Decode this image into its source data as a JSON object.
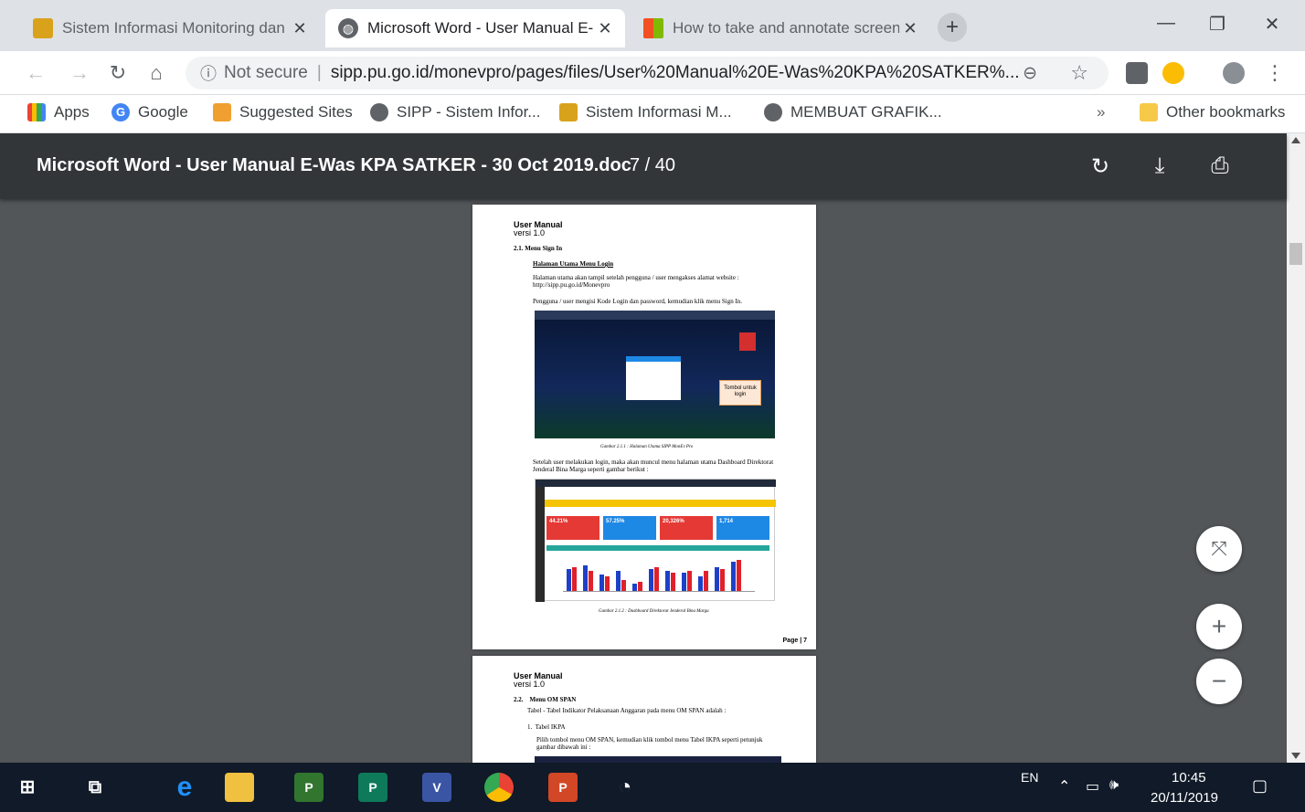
{
  "tabs": [
    {
      "title": "Sistem Informasi Monitoring dan",
      "active": false
    },
    {
      "title": "Microsoft Word - User Manual E-",
      "active": true
    },
    {
      "title": "How to take and annotate screen",
      "active": false
    }
  ],
  "omnibox": {
    "security": "Not secure",
    "url": "sipp.pu.go.id/monevpro/pages/files/User%20Manual%20E-Was%20KPA%20SATKER%..."
  },
  "bookmarks": [
    {
      "label": "Apps",
      "color": "#ea4335"
    },
    {
      "label": "Google",
      "color": "#4285f4"
    },
    {
      "label": "Suggested Sites",
      "color": "#f0a030"
    },
    {
      "label": "SIPP - Sistem Infor...",
      "color": "#5f6368"
    },
    {
      "label": "Sistem Informasi M...",
      "color": "#d9a21b"
    },
    {
      "label": "MEMBUAT GRAFIK...",
      "color": "#5f6368"
    }
  ],
  "bookmarks_overflow": "»",
  "other_bookmarks": "Other bookmarks",
  "pdf": {
    "title": "Microsoft Word - User Manual E-Was KPA SATKER - 30 Oct 2019.doc",
    "page_indicator": "7 / 40",
    "page1": {
      "header": "User Manual",
      "version": "versi 1.0",
      "section": "2.1. Menu Sign In",
      "subheading": "Halaman Utama Menu Login",
      "para1": "Halaman utama akan tampil setelah pengguna / user mengakses alamat website : http://sipp.pu.go.id/Monevpro",
      "para2": "Pengguna / user mengisi Kode Login dan password, kemudian klik menu Sign In.",
      "callout": "Tombol untuk login",
      "caption1": "Gambar 2.1.1 : Halaman Utama SIPP MonEv Pro",
      "para3": "Setelah user melakukan login, maka akan muncul menu halaman utama Dashboard Direktorat Jenderal Bina Marga seperti gambar berikut :",
      "stats": [
        "44.21%",
        "57.25%",
        "20,326%",
        "1,714"
      ],
      "caption2": "Gambar 2.1.2 : Dashboard Direktorat Jenderal Bina Marga",
      "page_no": "Page | 7"
    },
    "page2": {
      "header": "User Manual",
      "version": "versi 1.0",
      "section": "2.2.    Menu OM SPAN",
      "para1": "Tabel - Tabel Indikator Pelaksanaan Anggaran pada menu OM SPAN adalah :",
      "item1": "1.  Tabel IKPA",
      "para2": "Pilih tombol menu OM SPAN, kemudian klik tombol menu Tabel IKPA seperti petunjuk gambar dibawah ini :"
    }
  },
  "tray": {
    "lang": "EN",
    "time": "10:45",
    "date": "20/11/2019"
  }
}
